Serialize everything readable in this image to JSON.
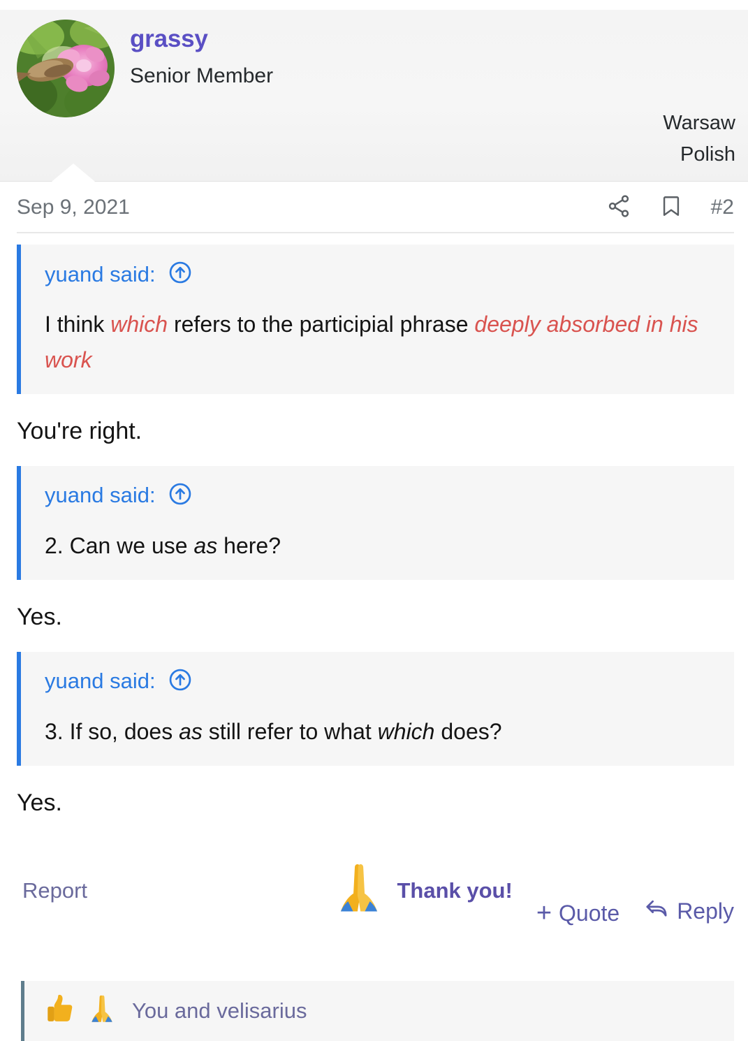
{
  "header": {
    "username": "grassy",
    "user_title": "Senior Member",
    "location": "Warsaw",
    "language": "Polish",
    "avatar_alt": "flower-avatar",
    "username_color": "#5a4fc4"
  },
  "meta": {
    "date": "Sep 9, 2021",
    "post_number": "#2",
    "share_icon": "share-icon",
    "bookmark_icon": "bookmark-icon"
  },
  "message": {
    "blocks": [
      {
        "type": "quote",
        "author_label": "yuand said:",
        "jump_icon": "arrow-up-circle-icon",
        "text_parts": [
          {
            "text": "I think ",
            "style": "normal"
          },
          {
            "text": "which",
            "style": "italic-red"
          },
          {
            "text": " refers to the participial phrase ",
            "style": "normal"
          },
          {
            "text": "deeply absorbed in his work",
            "style": "italic-red"
          }
        ],
        "plain_text": "I think which refers to the participial phrase deeply absorbed in his work"
      },
      {
        "type": "reply",
        "text": "You're right."
      },
      {
        "type": "quote",
        "author_label": "yuand said:",
        "jump_icon": "arrow-up-circle-icon",
        "text_parts": [
          {
            "text": "2. Can we use ",
            "style": "normal"
          },
          {
            "text": "as",
            "style": "italic"
          },
          {
            "text": " here?",
            "style": "normal"
          }
        ],
        "plain_text": "2. Can we use as here?"
      },
      {
        "type": "reply",
        "text": "Yes."
      },
      {
        "type": "quote",
        "author_label": "yuand said:",
        "jump_icon": "arrow-up-circle-icon",
        "text_parts": [
          {
            "text": "3. If so, does ",
            "style": "normal"
          },
          {
            "text": "as",
            "style": "italic"
          },
          {
            "text": " still refer to what ",
            "style": "normal"
          },
          {
            "text": "which",
            "style": "italic"
          },
          {
            "text": " does?",
            "style": "normal"
          }
        ],
        "plain_text": "3. If so, does as still refer to what which does?"
      },
      {
        "type": "reply",
        "text": "Yes."
      }
    ]
  },
  "footer": {
    "report_label": "Report",
    "thanks_label": "Thank you!",
    "thanks_emoji": "folded-hands-emoji",
    "quote_label": "Quote",
    "quote_plus": "+",
    "reply_label": "Reply",
    "reply_icon": "reply-arrow-icon"
  },
  "reactions": {
    "emojis": [
      "thumbs-up-emoji",
      "folded-hands-emoji"
    ],
    "text": "You and velisarius"
  },
  "colors": {
    "quote_border": "#2a7ae2",
    "quote_bg": "#f6f6f6",
    "link_purple": "#5a5aa8",
    "emphasis_red": "#d9534f"
  }
}
